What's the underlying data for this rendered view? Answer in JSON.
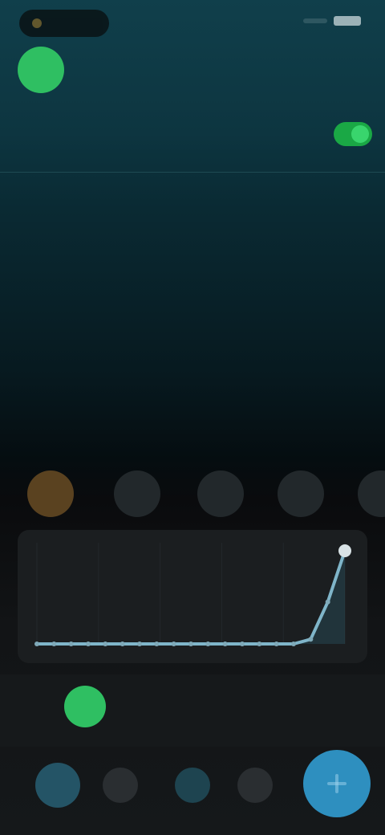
{
  "status": {
    "time": ""
  },
  "header": {
    "title": ""
  },
  "summary": {
    "label": "",
    "value": "",
    "toggle_label": ""
  },
  "month_label": "",
  "weekdays": [
    "",
    "",
    "",
    "",
    "",
    "",
    ""
  ],
  "calendar": {
    "days": [
      "",
      "",
      "",
      "",
      "",
      "",
      "",
      "",
      "",
      "",
      "",
      "",
      "",
      "",
      "",
      "",
      "",
      "",
      "",
      "",
      "",
      "",
      "",
      "",
      "",
      "",
      "",
      "",
      ""
    ]
  },
  "chips": [
    {
      "label": ""
    },
    {
      "label": ""
    },
    {
      "label": ""
    },
    {
      "label": ""
    },
    {
      "label": ""
    }
  ],
  "player": {
    "name": "",
    "value": ""
  },
  "chart_data": {
    "type": "line",
    "x": [
      1,
      2,
      3,
      4,
      5,
      6,
      7,
      8,
      9,
      10,
      11,
      12,
      13,
      14,
      15,
      16,
      17,
      18,
      19
    ],
    "values": [
      0,
      0,
      0,
      0,
      0,
      0,
      0,
      0,
      0,
      0,
      0,
      0,
      0,
      0,
      0,
      0,
      0.05,
      0.45,
      1.0
    ],
    "ylim": [
      0,
      1.0
    ]
  },
  "colors": {
    "accent_green": "#2fbf62",
    "accent_blue": "#2e8fbf",
    "accent_orange": "#d89a3a",
    "line": "#7fb5c9"
  }
}
